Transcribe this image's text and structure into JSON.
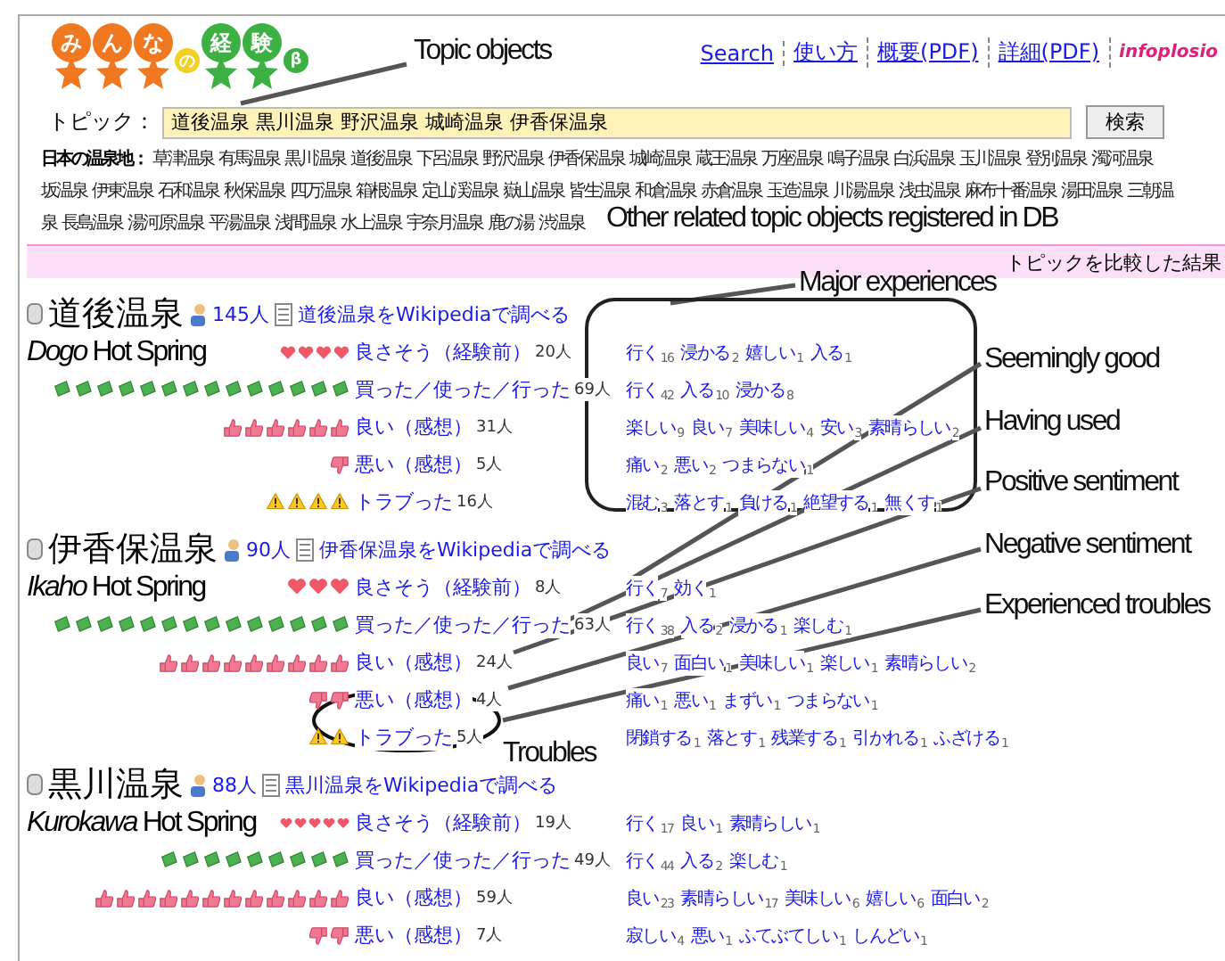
{
  "logo": {
    "parts": [
      {
        "text": "み",
        "color": "#f07820",
        "star": true
      },
      {
        "text": "ん",
        "color": "#f07820",
        "star": true
      },
      {
        "text": "な",
        "color": "#f07820",
        "star": true
      },
      {
        "text": "の",
        "color": "#f0d020",
        "star": false
      },
      {
        "text": "経",
        "color": "#3cb043",
        "star": true
      },
      {
        "text": "験",
        "color": "#3cb043",
        "star": true
      },
      {
        "text": "β",
        "color": "#3cb043",
        "star": false
      }
    ]
  },
  "nav": [
    {
      "text": "Search",
      "kind": "link"
    },
    {
      "text": "使い方",
      "kind": "link"
    },
    {
      "text": "概要(PDF)",
      "kind": "link"
    },
    {
      "text": "詳細(PDF)",
      "kind": "link"
    },
    {
      "text": "infoplosio",
      "kind": "brand"
    }
  ],
  "topic": {
    "label": "トピック：",
    "value": "道後温泉 黒川温泉 野沢温泉 城崎温泉 伊香保温泉",
    "button": "検索"
  },
  "spots": {
    "label": "日本の温泉地：",
    "lines": [
      [
        "草津温泉",
        "有馬温泉",
        "黒川温泉",
        "道後温泉",
        "下呂温泉",
        "野沢温泉",
        "伊香保温泉",
        "城崎温泉",
        "蔵王温泉",
        "万座温泉",
        "鳴子温泉",
        "白浜温泉",
        "玉川温泉",
        "登別温泉",
        "濁河温泉"
      ],
      [
        "坂温泉",
        "伊東温泉",
        "石和温泉",
        "秋保温泉",
        "四万温泉",
        "箱根温泉",
        "定山渓温泉",
        "嶽山温泉",
        "皆生温泉",
        "和倉温泉",
        "赤倉温泉",
        "玉造温泉",
        "川湯温泉",
        "浅虫温泉",
        "麻布十番温泉",
        "湯田温泉",
        "三朝温"
      ],
      [
        "泉",
        "長島温泉",
        "湯河原温泉",
        "平湯温泉",
        "浅間温泉",
        "水上温泉",
        "宇奈月温泉",
        "鹿の湯",
        "渋温泉"
      ]
    ]
  },
  "result_bar": "トピックを比較した結果",
  "topics": [
    {
      "name": "道後温泉",
      "english": "Dogo",
      "english_rest": "Hot Spring",
      "people": "145人",
      "wiki": "道後温泉をWikipediaで調べる",
      "rows": [
        {
          "icons": [
            {
              "kind": "heart"
            },
            {
              "kind": "heart"
            },
            {
              "kind": "heart"
            },
            {
              "kind": "heart"
            }
          ],
          "label": "良さそう（経験前）",
          "count": "20人",
          "words": [
            {
              "text": "行く",
              "n": "16"
            },
            {
              "text": "浸かる",
              "n": "2"
            },
            {
              "text": "嬉しい",
              "n": "1"
            },
            {
              "text": "入る",
              "n": "1"
            }
          ]
        },
        {
          "icons": [
            {
              "kind": "banknote"
            },
            {
              "kind": "banknote"
            },
            {
              "kind": "banknote"
            },
            {
              "kind": "banknote"
            },
            {
              "kind": "banknote"
            },
            {
              "kind": "banknote"
            },
            {
              "kind": "banknote"
            },
            {
              "kind": "banknote"
            },
            {
              "kind": "banknote"
            },
            {
              "kind": "banknote"
            },
            {
              "kind": "banknote"
            },
            {
              "kind": "banknote"
            },
            {
              "kind": "banknote"
            },
            {
              "kind": "banknote"
            }
          ],
          "label": "買った／使った／行った",
          "count": "69人",
          "words": [
            {
              "text": "行く",
              "n": "42"
            },
            {
              "text": "入る",
              "n": "10"
            },
            {
              "text": "浸かる",
              "n": "8"
            }
          ]
        },
        {
          "icons": [
            {
              "kind": "thumbs-up"
            },
            {
              "kind": "thumbs-up"
            },
            {
              "kind": "thumbs-up"
            },
            {
              "kind": "thumbs-up"
            },
            {
              "kind": "thumbs-up"
            },
            {
              "kind": "thumbs-up"
            }
          ],
          "label": "良い（感想）",
          "count": "31人",
          "words": [
            {
              "text": "楽しい",
              "n": "9"
            },
            {
              "text": "良い",
              "n": "7"
            },
            {
              "text": "美味しい",
              "n": "4"
            },
            {
              "text": "安い",
              "n": "3"
            },
            {
              "text": "素晴らしい",
              "n": "2"
            }
          ]
        },
        {
          "icons": [
            {
              "kind": "thumbs-down"
            }
          ],
          "label": "悪い（感想）",
          "count": "5人",
          "words": [
            {
              "text": "痛い",
              "n": "2"
            },
            {
              "text": "悪い",
              "n": "2"
            },
            {
              "text": "つまらない",
              "n": "1"
            }
          ]
        },
        {
          "icons": [
            {
              "kind": "warning"
            },
            {
              "kind": "warning"
            },
            {
              "kind": "warning"
            },
            {
              "kind": "warning"
            }
          ],
          "label": "トラブった",
          "count": "16人",
          "words": [
            {
              "text": "混む",
              "n": "3"
            },
            {
              "text": "落とす",
              "n": "1"
            },
            {
              "text": "負ける",
              "n": "1"
            },
            {
              "text": "絶望する",
              "n": "1"
            },
            {
              "text": "無くす",
              "n": "1"
            }
          ]
        }
      ]
    },
    {
      "name": "伊香保温泉",
      "english": "Ikaho",
      "english_rest": "Hot Spring",
      "people": "90人",
      "wiki": "伊香保温泉をWikipediaで調べる",
      "rows": [
        {
          "icons": [
            {
              "kind": "heart"
            },
            {
              "kind": "heart"
            },
            {
              "kind": "heart"
            }
          ],
          "label": "良さそう（経験前）",
          "count": "8人",
          "words": [
            {
              "text": "行く",
              "n": "7"
            },
            {
              "text": "効く",
              "n": "1"
            }
          ]
        },
        {
          "icons": [
            {
              "kind": "banknote"
            },
            {
              "kind": "banknote"
            },
            {
              "kind": "banknote"
            },
            {
              "kind": "banknote"
            },
            {
              "kind": "banknote"
            },
            {
              "kind": "banknote"
            },
            {
              "kind": "banknote"
            },
            {
              "kind": "banknote"
            },
            {
              "kind": "banknote"
            },
            {
              "kind": "banknote"
            },
            {
              "kind": "banknote"
            },
            {
              "kind": "banknote"
            },
            {
              "kind": "banknote"
            },
            {
              "kind": "banknote"
            }
          ],
          "label": "買った／使った／行った",
          "count": "63人",
          "words": [
            {
              "text": "行く",
              "n": "38"
            },
            {
              "text": "入る",
              "n": "2"
            },
            {
              "text": "浸かる",
              "n": "1"
            },
            {
              "text": "楽しむ",
              "n": "1"
            }
          ]
        },
        {
          "icons": [
            {
              "kind": "thumbs-up"
            },
            {
              "kind": "thumbs-up"
            },
            {
              "kind": "thumbs-up"
            },
            {
              "kind": "thumbs-up"
            },
            {
              "kind": "thumbs-up"
            },
            {
              "kind": "thumbs-up"
            },
            {
              "kind": "thumbs-up"
            },
            {
              "kind": "thumbs-up"
            },
            {
              "kind": "thumbs-up"
            }
          ],
          "label": "良い（感想）",
          "count": "24人",
          "words": [
            {
              "text": "良い",
              "n": "7"
            },
            {
              "text": "面白い",
              "n": "1"
            },
            {
              "text": "美味しい",
              "n": "1"
            },
            {
              "text": "楽しい",
              "n": "1"
            },
            {
              "text": "素晴らしい",
              "n": "2"
            }
          ]
        },
        {
          "icons": [
            {
              "kind": "thumbs-down"
            },
            {
              "kind": "thumbs-down"
            }
          ],
          "label": "悪い（感想）",
          "count": "4人",
          "words": [
            {
              "text": "痛い",
              "n": "1"
            },
            {
              "text": "悪い",
              "n": "1"
            },
            {
              "text": "まずい",
              "n": "1"
            },
            {
              "text": "つまらない",
              "n": "1"
            }
          ]
        },
        {
          "icons": [
            {
              "kind": "warning"
            },
            {
              "kind": "warning"
            }
          ],
          "label": "トラブった",
          "count": "5人",
          "words": [
            {
              "text": "閉鎖する",
              "n": "1"
            },
            {
              "text": "落とす",
              "n": "1"
            },
            {
              "text": "残業する",
              "n": "1"
            },
            {
              "text": "引かれる",
              "n": "1"
            },
            {
              "text": "ふざける",
              "n": "1"
            }
          ]
        }
      ]
    },
    {
      "name": "黒川温泉",
      "english": "Kurokawa",
      "english_rest": "Hot Spring",
      "people": "88人",
      "wiki": "黒川温泉をWikipediaで調べる",
      "rows": [
        {
          "icons": [
            {
              "kind": "heart"
            },
            {
              "kind": "heart"
            },
            {
              "kind": "heart"
            },
            {
              "kind": "heart"
            },
            {
              "kind": "heart"
            }
          ],
          "label": "良さそう（経験前）",
          "count": "19人",
          "words": [
            {
              "text": "行く",
              "n": "17"
            },
            {
              "text": "良い",
              "n": "1"
            },
            {
              "text": "素晴らしい",
              "n": "1"
            }
          ]
        },
        {
          "icons": [
            {
              "kind": "banknote"
            },
            {
              "kind": "banknote"
            },
            {
              "kind": "banknote"
            },
            {
              "kind": "banknote"
            },
            {
              "kind": "banknote"
            },
            {
              "kind": "banknote"
            },
            {
              "kind": "banknote"
            },
            {
              "kind": "banknote"
            },
            {
              "kind": "banknote"
            }
          ],
          "label": "買った／使った／行った",
          "count": "49人",
          "words": [
            {
              "text": "行く",
              "n": "44"
            },
            {
              "text": "入る",
              "n": "2"
            },
            {
              "text": "楽しむ",
              "n": "1"
            }
          ]
        },
        {
          "icons": [
            {
              "kind": "thumbs-up"
            },
            {
              "kind": "thumbs-up"
            },
            {
              "kind": "thumbs-up"
            },
            {
              "kind": "thumbs-up"
            },
            {
              "kind": "thumbs-up"
            },
            {
              "kind": "thumbs-up"
            },
            {
              "kind": "thumbs-up"
            },
            {
              "kind": "thumbs-up"
            },
            {
              "kind": "thumbs-up"
            },
            {
              "kind": "thumbs-up"
            },
            {
              "kind": "thumbs-up"
            },
            {
              "kind": "thumbs-up"
            }
          ],
          "label": "良い（感想）",
          "count": "59人",
          "words": [
            {
              "text": "良い",
              "n": "23"
            },
            {
              "text": "素晴らしい",
              "n": "17"
            },
            {
              "text": "美味しい",
              "n": "6"
            },
            {
              "text": "嬉しい",
              "n": "6"
            },
            {
              "text": "面白い",
              "n": "2"
            }
          ]
        },
        {
          "icons": [
            {
              "kind": "thumbs-down"
            },
            {
              "kind": "thumbs-down"
            }
          ],
          "label": "悪い（感想）",
          "count": "7人",
          "words": [
            {
              "text": "寂しい",
              "n": "4"
            },
            {
              "text": "悪い",
              "n": "1"
            },
            {
              "text": "ふてぶてしい",
              "n": "1"
            },
            {
              "text": "しんどい",
              "n": "1"
            }
          ]
        }
      ]
    }
  ],
  "annotations": [
    "Topic objects",
    "Other related topic objects registered in DB",
    "Major experiences",
    "Seemingly good",
    "Having used",
    "Positive sentiment",
    "Negative sentiment",
    "Experienced troubles",
    "Troubles"
  ]
}
